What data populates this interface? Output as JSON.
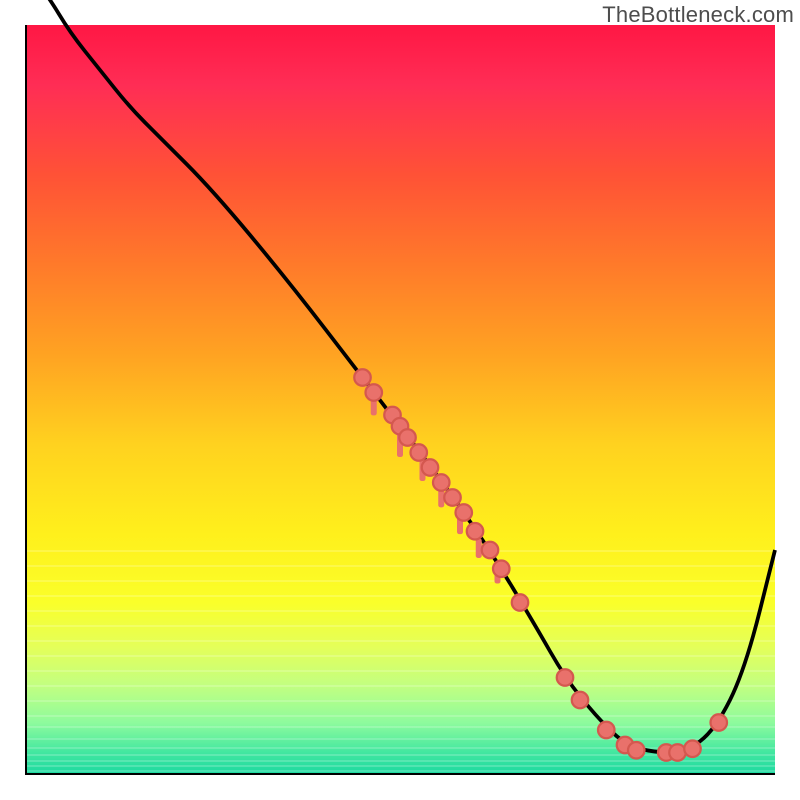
{
  "watermark": "TheBottleneck.com",
  "colors": {
    "curve": "#000000",
    "point_fill": "#e9716b",
    "point_stroke": "#d4584f",
    "axis": "#000000"
  },
  "chart_data": {
    "type": "line",
    "title": "",
    "xlabel": "",
    "ylabel": "",
    "xlim": [
      0,
      100
    ],
    "ylim": [
      0,
      100
    ],
    "series": [
      {
        "name": "bottleneck-curve",
        "x": [
          0,
          3,
          6,
          10,
          14,
          18,
          25,
          35,
          45,
          55,
          62,
          68,
          72,
          76,
          80,
          84,
          88,
          92,
          96,
          100
        ],
        "y": [
          108,
          104,
          99,
          94,
          89,
          85,
          78,
          66,
          53,
          40,
          30,
          20,
          13,
          8,
          4,
          3,
          3,
          6,
          14,
          30
        ]
      }
    ],
    "points_on_curve": [
      {
        "x": 45.0,
        "y": 53.0
      },
      {
        "x": 46.5,
        "y": 51.0
      },
      {
        "x": 49.0,
        "y": 48.0
      },
      {
        "x": 50.0,
        "y": 46.5
      },
      {
        "x": 51.0,
        "y": 45.0
      },
      {
        "x": 52.5,
        "y": 43.0
      },
      {
        "x": 54.0,
        "y": 41.0
      },
      {
        "x": 55.5,
        "y": 39.0
      },
      {
        "x": 57.0,
        "y": 37.0
      },
      {
        "x": 58.5,
        "y": 35.0
      },
      {
        "x": 60.0,
        "y": 32.5
      },
      {
        "x": 62.0,
        "y": 30.0
      },
      {
        "x": 63.5,
        "y": 27.5
      },
      {
        "x": 66.0,
        "y": 23.0
      },
      {
        "x": 72.0,
        "y": 13.0
      },
      {
        "x": 74.0,
        "y": 10.0
      },
      {
        "x": 77.5,
        "y": 6.0
      },
      {
        "x": 80.0,
        "y": 4.0
      },
      {
        "x": 81.5,
        "y": 3.3
      },
      {
        "x": 85.5,
        "y": 3.0
      },
      {
        "x": 87.0,
        "y": 3.0
      },
      {
        "x": 89.0,
        "y": 3.5
      },
      {
        "x": 92.5,
        "y": 7.0
      }
    ],
    "tick_markers_x_at_bottom": [
      {
        "x": 46.5,
        "w": 2.5
      },
      {
        "x": 50.0,
        "w": 3.5
      },
      {
        "x": 53.0,
        "w": 2.8
      },
      {
        "x": 55.5,
        "w": 3.0
      },
      {
        "x": 58.0,
        "w": 3.0
      },
      {
        "x": 60.5,
        "w": 2.6
      },
      {
        "x": 63.0,
        "w": 2.2
      }
    ],
    "bottom_band_stripes_y": [
      70,
      72,
      74,
      76,
      78,
      80,
      82,
      84,
      86,
      88,
      90,
      92,
      93.5,
      95,
      96.2,
      97.2,
      98,
      98.7,
      99.3
    ]
  }
}
